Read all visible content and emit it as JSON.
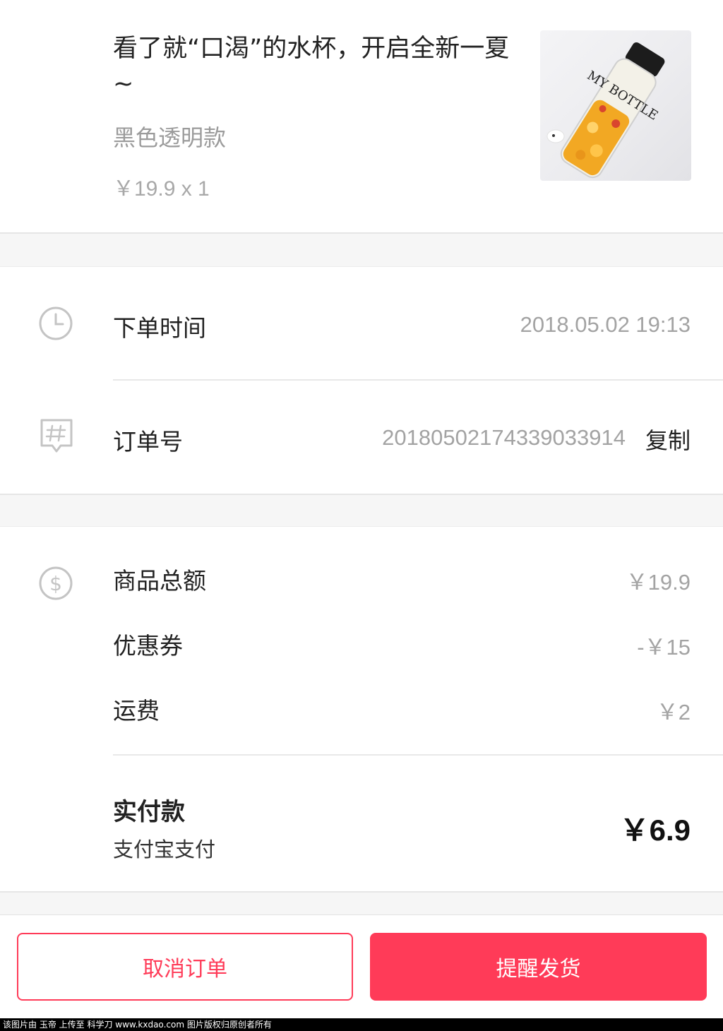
{
  "product": {
    "title": "看了就“口渴”的水杯，开启全新一夏~",
    "variant": "黑色透明款",
    "price_qty": "￥19.9 x 1",
    "image_text": "MY BOTTLE"
  },
  "order_info": {
    "order_time_label": "下单时间",
    "order_time_value": "2018.05.02 19:13",
    "order_no_label": "订单号",
    "order_no_value": "20180502174339033914",
    "copy_label": "复制",
    "clock_icon": "clock-icon",
    "hash_icon": "hash-tag-icon"
  },
  "amounts": {
    "dollar_icon": "dollar-circle-icon",
    "rows": [
      {
        "label": "商品总额",
        "value": "￥19.9"
      },
      {
        "label": "优惠券",
        "value": "-￥15"
      },
      {
        "label": "运费",
        "value": "￥2"
      }
    ],
    "total_label": "实付款",
    "payment_method": "支付宝支付",
    "total_value": "￥6.9"
  },
  "actions": {
    "cancel_label": "取消订单",
    "remind_label": "提醒发货"
  },
  "watermark": "该图片由 玉帝 上传至 科学刀 www.kxdao.com 图片版权归原创者所有",
  "colors": {
    "accent": "#ff3b58",
    "muted_text": "#a3a3a3",
    "page_bg": "#f6f6f6"
  }
}
